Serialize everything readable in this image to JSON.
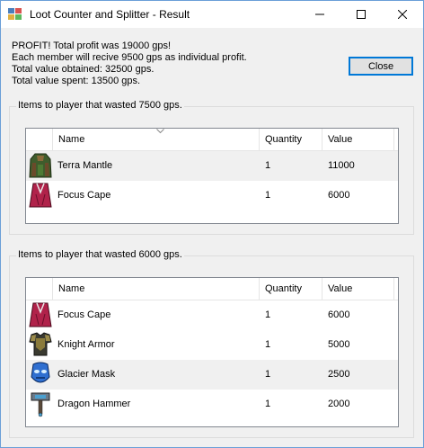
{
  "window": {
    "title": "Loot Counter and Splitter - Result"
  },
  "summary": {
    "lines": [
      "PROFIT! Total profit was 19000 gps!",
      "Each member will recive 9500 gps as individual profit.",
      "Total value obtained: 32500 gps.",
      "Total value spent: 13500 gps."
    ]
  },
  "close_label": "Close",
  "columns": {
    "name": "Name",
    "quantity": "Quantity",
    "value": "Value"
  },
  "groups": [
    {
      "legend": "Items to player that wasted 7500 gps.",
      "items": [
        {
          "icon": "terra-mantle-icon",
          "name": "Terra Mantle",
          "quantity": "1",
          "value": "11000"
        },
        {
          "icon": "focus-cape-icon",
          "name": "Focus Cape",
          "quantity": "1",
          "value": "6000"
        }
      ]
    },
    {
      "legend": "Items to player that wasted 6000 gps.",
      "items": [
        {
          "icon": "focus-cape-icon",
          "name": "Focus Cape",
          "quantity": "1",
          "value": "6000"
        },
        {
          "icon": "knight-armor-icon",
          "name": "Knight Armor",
          "quantity": "1",
          "value": "5000"
        },
        {
          "icon": "glacier-mask-icon",
          "name": "Glacier Mask",
          "quantity": "1",
          "value": "2500"
        },
        {
          "icon": "dragon-hammer-icon",
          "name": "Dragon Hammer",
          "quantity": "1",
          "value": "2000"
        }
      ]
    }
  ]
}
